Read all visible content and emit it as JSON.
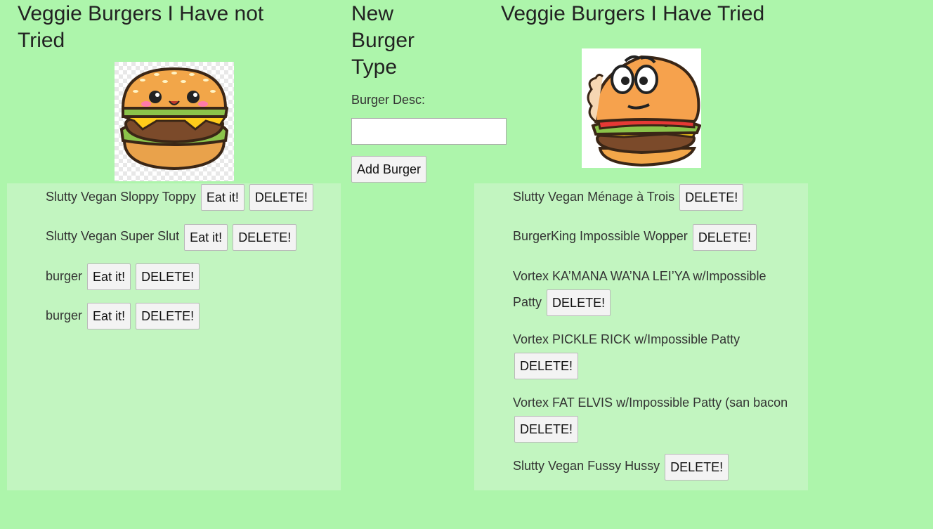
{
  "left": {
    "heading": "Veggie Burgers I Have not Tried",
    "image_icon": "happy-burger-icon",
    "items": [
      {
        "name": "Slutty Vegan Sloppy Toppy",
        "eat_label": "Eat it!",
        "delete_label": "DELETE!"
      },
      {
        "name": "Slutty Vegan Super Slut",
        "eat_label": "Eat it!",
        "delete_label": "DELETE!"
      },
      {
        "name": "burger",
        "eat_label": "Eat it!",
        "delete_label": "DELETE!"
      },
      {
        "name": "burger",
        "eat_label": "Eat it!",
        "delete_label": "DELETE!"
      }
    ]
  },
  "form": {
    "heading": "New Burger Type",
    "label": "Burger Desc:",
    "input_value": "",
    "submit_label": "Add Burger"
  },
  "right": {
    "heading": "Veggie Burgers I Have Tried",
    "image_icon": "bitten-burger-icon",
    "items": [
      {
        "name": "Slutty Vegan Ménage à Trois",
        "delete_label": "DELETE!"
      },
      {
        "name": "BurgerKing Impossible Wopper",
        "delete_label": "DELETE!"
      },
      {
        "name": "Vortex KA’MANA WA’NA LEI’YA w/Impossible Patty",
        "delete_label": "DELETE!"
      },
      {
        "name": "Vortex PICKLE RICK w/Impossible Patty",
        "delete_label": "DELETE!"
      },
      {
        "name": "Vortex FAT ELVIS w/Impossible Patty (san bacon",
        "delete_label": "DELETE!"
      },
      {
        "name": "Slutty Vegan Fussy Hussy",
        "delete_label": "DELETE!"
      }
    ]
  },
  "colors": {
    "background": "#adf5ab",
    "panel": "#c2f5c0"
  }
}
